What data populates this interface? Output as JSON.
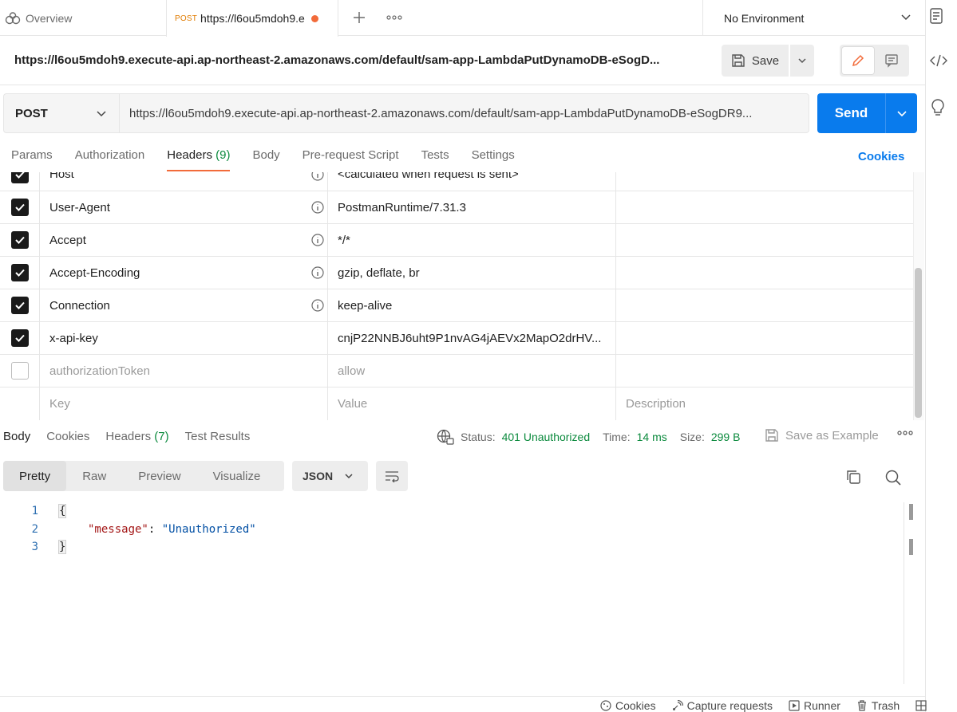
{
  "tabs": {
    "overview_label": "Overview",
    "active": {
      "method": "POST",
      "title": "https://l6ou5mdoh9.e"
    }
  },
  "environment": {
    "selected": "No Environment"
  },
  "request": {
    "name": "https://l6ou5mdoh9.execute-api.ap-northeast-2.amazonaws.com/default/sam-app-LambdaPutDynamoDB-eSogD...",
    "save_label": "Save",
    "method": "POST",
    "url": "https://l6ou5mdoh9.execute-api.ap-northeast-2.amazonaws.com/default/sam-app-LambdaPutDynamoDB-eSogDR9...",
    "send_label": "Send"
  },
  "request_tabs": {
    "params": "Params",
    "authorization": "Authorization",
    "headers": "Headers",
    "headers_count": "(9)",
    "body": "Body",
    "prerequest": "Pre-request Script",
    "tests": "Tests",
    "settings": "Settings",
    "cookies": "Cookies"
  },
  "headers_table": {
    "rows": [
      {
        "key": "Host",
        "value": "<calculated when request is sent>",
        "checked": true
      },
      {
        "key": "User-Agent",
        "value": "PostmanRuntime/7.31.3",
        "checked": true
      },
      {
        "key": "Accept",
        "value": "*/*",
        "checked": true
      },
      {
        "key": "Accept-Encoding",
        "value": "gzip, deflate, br",
        "checked": true
      },
      {
        "key": "Connection",
        "value": "keep-alive",
        "checked": true
      },
      {
        "key": "x-api-key",
        "value": "cnjP22NNBJ6uht9P1nvAG4jAEVx2MapO2drHV...",
        "checked": true
      },
      {
        "key": "authorizationToken",
        "value": "allow",
        "checked": false
      }
    ],
    "placeholder": {
      "key": "Key",
      "value": "Value",
      "description": "Description"
    }
  },
  "response": {
    "tabs": {
      "body": "Body",
      "cookies": "Cookies",
      "headers": "Headers",
      "headers_count": "(7)",
      "test_results": "Test Results"
    },
    "status_label": "Status:",
    "status_value": "401 Unauthorized",
    "time_label": "Time:",
    "time_value": "14 ms",
    "size_label": "Size:",
    "size_value": "299 B",
    "save_example": "Save as Example",
    "views": {
      "pretty": "Pretty",
      "raw": "Raw",
      "preview": "Preview",
      "visualize": "Visualize"
    },
    "language": "JSON",
    "code": {
      "line1": "1",
      "line2": "2",
      "line3": "3",
      "open": "{",
      "key": "\"message\"",
      "colon": ": ",
      "value": "\"Unauthorized\"",
      "close": "}"
    }
  },
  "footer": {
    "cookies": "Cookies",
    "capture": "Capture requests",
    "runner": "Runner",
    "trash": "Trash"
  },
  "colors": {
    "accent": "#097bed",
    "tab_underline": "#f26b3a",
    "status_ok_text": "#0b8a3d"
  }
}
